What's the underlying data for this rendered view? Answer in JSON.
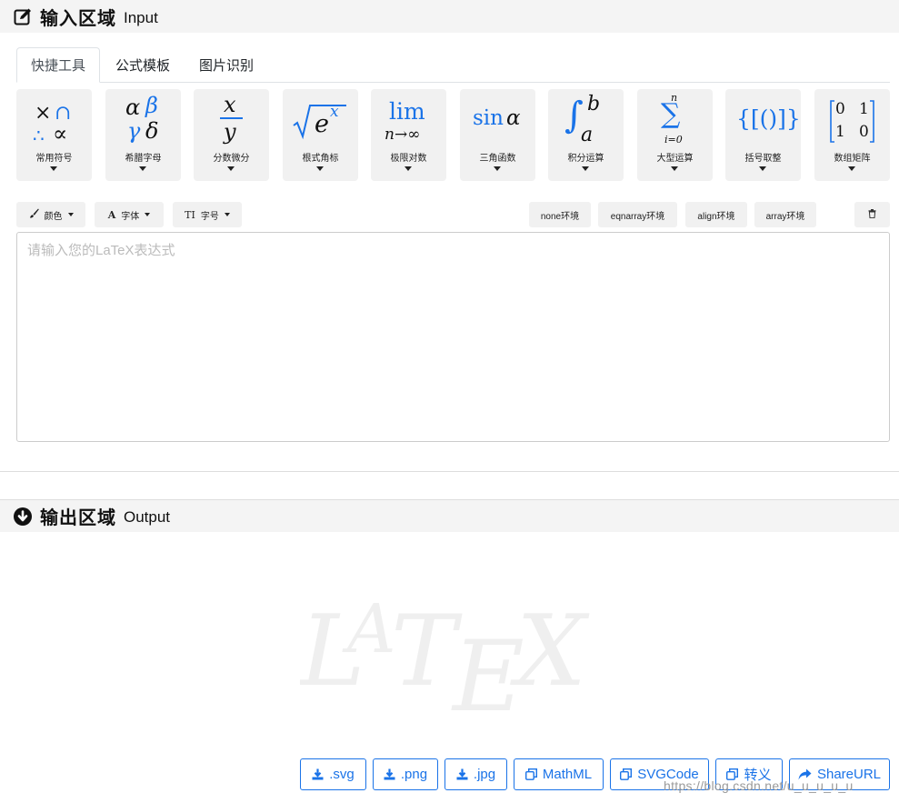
{
  "input_section": {
    "title_cn": "输入区域",
    "title_en": "Input"
  },
  "tabs": [
    {
      "label": "快捷工具",
      "active": true
    },
    {
      "label": "公式模板",
      "active": false
    },
    {
      "label": "图片识别",
      "active": false
    }
  ],
  "tools": [
    {
      "label": "常用符号"
    },
    {
      "label": "希腊字母"
    },
    {
      "label": "分数微分"
    },
    {
      "label": "根式角标"
    },
    {
      "label": "极限对数"
    },
    {
      "label": "三角函数"
    },
    {
      "label": "积分运算"
    },
    {
      "label": "大型运算"
    },
    {
      "label": "括号取整"
    },
    {
      "label": "数组矩阵"
    }
  ],
  "glyphs": {
    "greek": [
      "α",
      "β",
      "γ",
      "δ"
    ],
    "fraction": [
      "x",
      "y"
    ],
    "root": [
      "e",
      "x"
    ],
    "limit": [
      "lim",
      "n→∞"
    ],
    "trig": [
      "sin",
      "α"
    ],
    "integral": [
      "∫",
      "b",
      "a"
    ],
    "sum": [
      "∑",
      "n",
      "i=0"
    ],
    "brackets": "{[()]}",
    "matrix": [
      "0",
      "1",
      "1",
      "0"
    ]
  },
  "format": {
    "color_label": "颜色",
    "font_label": "字体",
    "size_label": "字号"
  },
  "envs": [
    "none环境",
    "eqnarray环境",
    "align环境",
    "array环境"
  ],
  "editor": {
    "placeholder": "请输入您的LaTeX表达式",
    "value": ""
  },
  "output_section": {
    "title_cn": "输出区域",
    "title_en": "Output"
  },
  "watermark_text": "LATEX",
  "downloads": [
    {
      "label": ".svg",
      "icon": "download-icon"
    },
    {
      "label": ".png",
      "icon": "download-icon"
    },
    {
      "label": ".jpg",
      "icon": "download-icon"
    },
    {
      "label": "MathML",
      "icon": "copy-icon"
    },
    {
      "label": "SVGCode",
      "icon": "copy-icon"
    },
    {
      "label": "转义",
      "icon": "copy-icon"
    },
    {
      "label": "ShareURL",
      "icon": "share-icon"
    }
  ],
  "url_watermark": "https://blog.csdn.net/u_u_u_u_u",
  "colors": {
    "accent": "#1a73e8",
    "panel": "#f1f1f1",
    "header": "#f4f4f4"
  }
}
